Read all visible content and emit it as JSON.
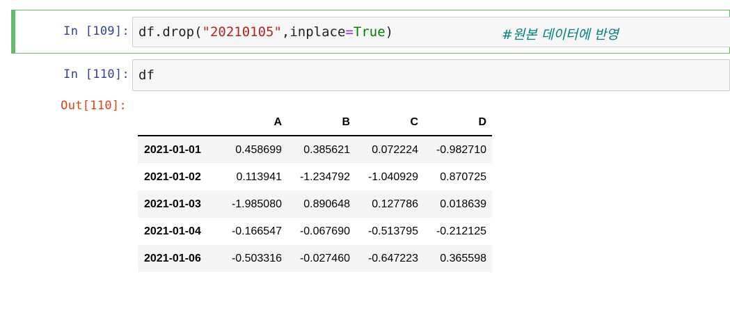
{
  "cells": [
    {
      "prompt": "In [109]:",
      "code": {
        "prefix": "df.drop(",
        "string": "\"20210105\"",
        "mid": ",inplace",
        "op": "=",
        "keyword": "True",
        "suffix": ")",
        "comment": "#원본 데이터에 반영"
      }
    },
    {
      "prompt": "In [110]:",
      "code": {
        "text": "df"
      },
      "out_prompt": "Out[110]:"
    }
  ],
  "dataframe": {
    "columns": [
      "",
      "A",
      "B",
      "C",
      "D"
    ],
    "rows": [
      {
        "index": "2021-01-01",
        "values": [
          "0.458699",
          "0.385621",
          "0.072224",
          "-0.982710"
        ]
      },
      {
        "index": "2021-01-02",
        "values": [
          "0.113941",
          "-1.234792",
          "-1.040929",
          "0.870725"
        ]
      },
      {
        "index": "2021-01-03",
        "values": [
          "-1.985080",
          "0.890648",
          "0.127786",
          "0.018639"
        ]
      },
      {
        "index": "2021-01-04",
        "values": [
          "-0.166547",
          "-0.067690",
          "-0.513795",
          "-0.212125"
        ]
      },
      {
        "index": "2021-01-06",
        "values": [
          "-0.503316",
          "-0.027460",
          "-0.647223",
          "0.365598"
        ]
      }
    ]
  },
  "colors": {
    "selected_border": "#66bb6a",
    "in_prompt": "#303f9f",
    "out_prompt": "#d84315",
    "string": "#ba2121",
    "keyword": "#008000",
    "comment": "#008080"
  }
}
